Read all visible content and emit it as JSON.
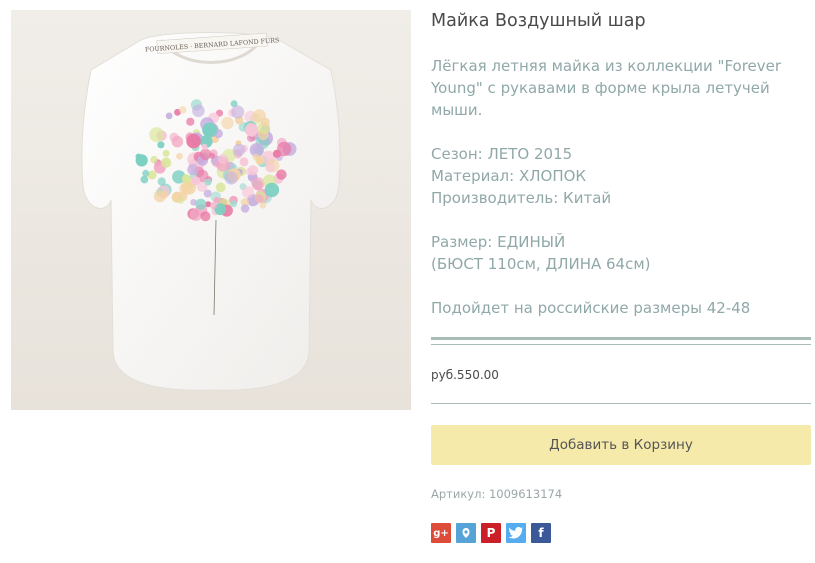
{
  "product": {
    "title": "Майка Воздушный шар",
    "description": "Лёгкая летняя майка из коллекции \"Forever Young\" с рукавами в форме крыла летучей мыши.",
    "season": "Сезон: ЛЕТО 2015",
    "material": "Материал: ХЛОПОК",
    "manufacturer": "Производитель: Китай",
    "size": "Размер: ЕДИНЫЙ",
    "size_details": "(БЮСТ 110см, ДЛИНА 64см)",
    "fits": "Подойдет на российские размеры 42-48",
    "price": "руб.550.00",
    "add_to_cart": "Добавить в Корзину",
    "sku": "Артикул: 1009613174"
  },
  "photo": {
    "alt": "white t-shirt with balloon print",
    "label_text": "FOURNOLES · BERNARD LAFOND FURS"
  },
  "social": {
    "google": "g+",
    "livejournal": "lj",
    "pinterest": "P",
    "twitter": "t",
    "facebook": "f"
  },
  "colors": {
    "button_bg": "#f6eaaa",
    "description_text": "#91a8a8",
    "divider": "#a9bcb8"
  }
}
